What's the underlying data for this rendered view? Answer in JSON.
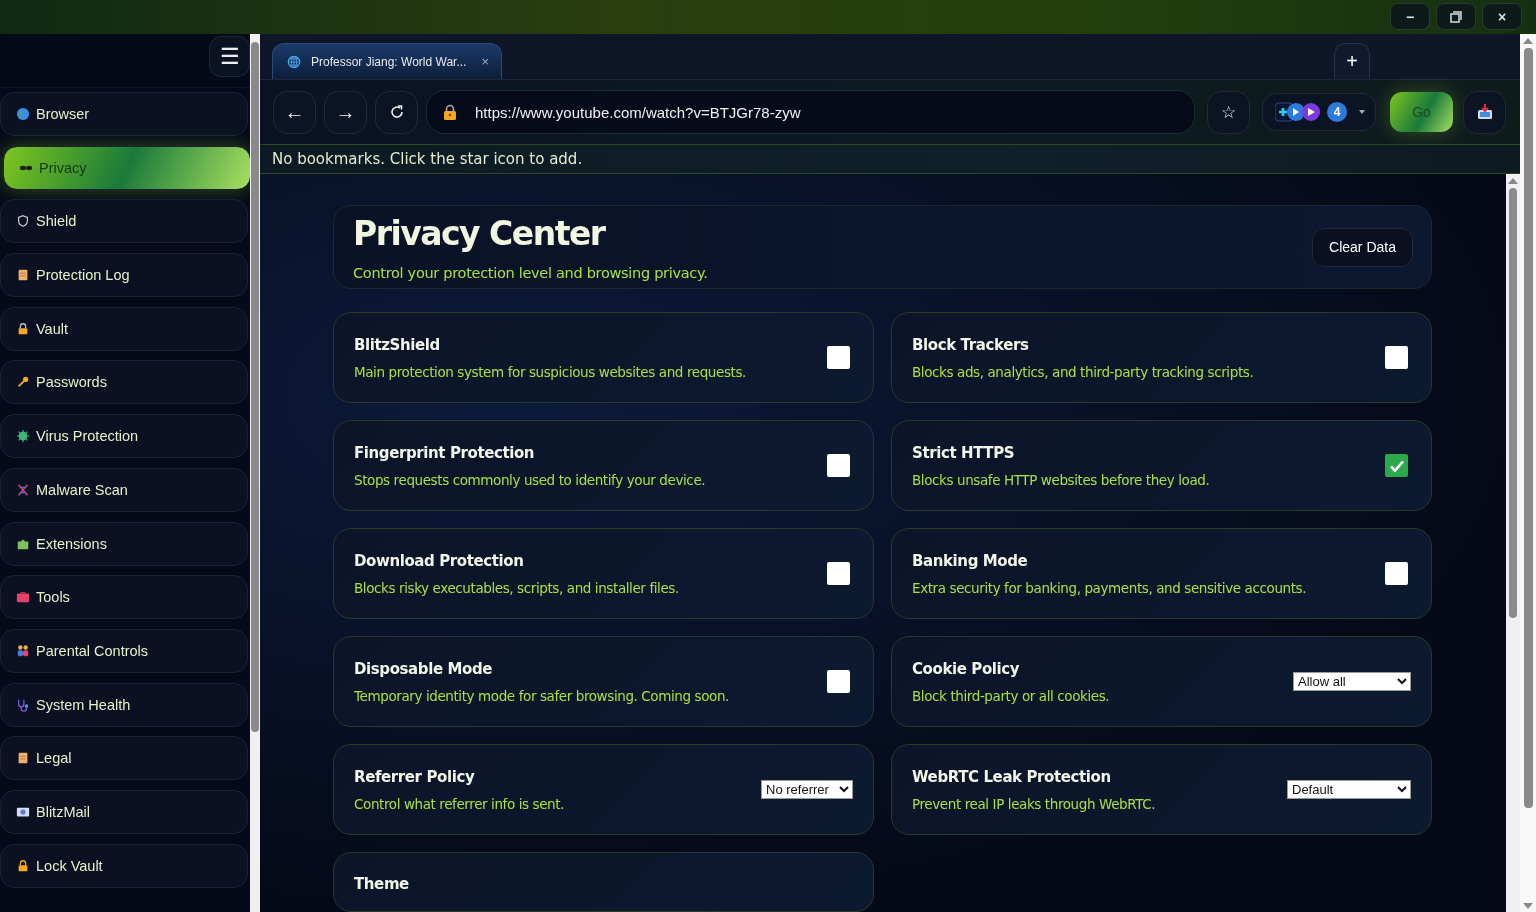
{
  "window_controls": [
    "−",
    "×"
  ],
  "sidebar": {
    "menu_glyph": "☰",
    "items": [
      {
        "label": "Browser",
        "selected": false
      },
      {
        "label": "Privacy",
        "selected": true
      },
      {
        "label": "Shield",
        "selected": false
      },
      {
        "label": "Protection Log",
        "selected": false
      },
      {
        "label": "Vault",
        "selected": false
      },
      {
        "label": "Passwords",
        "selected": false
      },
      {
        "label": "Virus Protection",
        "selected": false
      },
      {
        "label": "Malware Scan",
        "selected": false
      },
      {
        "label": "Extensions",
        "selected": false
      },
      {
        "label": "Tools",
        "selected": false
      },
      {
        "label": "Parental Controls",
        "selected": false
      },
      {
        "label": "System Health",
        "selected": false
      },
      {
        "label": "Legal",
        "selected": false
      },
      {
        "label": "BlitzMail",
        "selected": false
      },
      {
        "label": "Lock Vault",
        "selected": false
      }
    ]
  },
  "tabs": [
    {
      "title": "Professor Jiang: World War...",
      "close": "×",
      "selected": true
    }
  ],
  "new_tab": "+",
  "toolbar": {
    "back": "←",
    "forward": "→",
    "url": "https://www.youtube.com/watch?v=BTJGr78-zyw",
    "star": "☆",
    "extension_count": "4",
    "go": "Go"
  },
  "bookmarks_bar": "No bookmarks. Click the star icon to add.",
  "header": {
    "title": "Privacy Center",
    "subtitle": "Control your protection level and browsing privacy.",
    "button": "Clear Data"
  },
  "settings": [
    {
      "kind": "checkbox",
      "title": "BlitzShield",
      "description": "Main protection system for suspicious websites and requests.",
      "checked": false
    },
    {
      "kind": "checkbox",
      "title": "Block Trackers",
      "description": "Blocks ads, analytics, and third-party tracking scripts.",
      "checked": false
    },
    {
      "kind": "checkbox",
      "title": "Fingerprint Protection",
      "description": "Stops requests commonly used to identify your device.",
      "checked": false
    },
    {
      "kind": "checkbox",
      "title": "Strict HTTPS",
      "description": "Blocks unsafe HTTP websites before they load.",
      "checked": true
    },
    {
      "kind": "checkbox",
      "title": "Download Protection",
      "description": "Blocks risky executables, scripts, and installer files.",
      "checked": false
    },
    {
      "kind": "checkbox",
      "title": "Banking Mode",
      "description": "Extra security for banking, payments, and sensitive accounts.",
      "checked": false
    },
    {
      "kind": "checkbox",
      "title": "Disposable Mode",
      "description": "Temporary identity mode for safer browsing. Coming soon.",
      "checked": false
    },
    {
      "kind": "select",
      "title": "Cookie Policy",
      "description": "Block third-party or all cookies.",
      "value": "Allow all"
    },
    {
      "kind": "select",
      "title": "Referrer Policy",
      "description": "Control what referrer info is sent.",
      "value": "No referrer"
    },
    {
      "kind": "select",
      "title": "WebRTC Leak Protection",
      "description": "Prevent real IP leaks through WebRTC.",
      "value": "Default"
    },
    {
      "kind": "heading",
      "title": "Theme"
    }
  ]
}
